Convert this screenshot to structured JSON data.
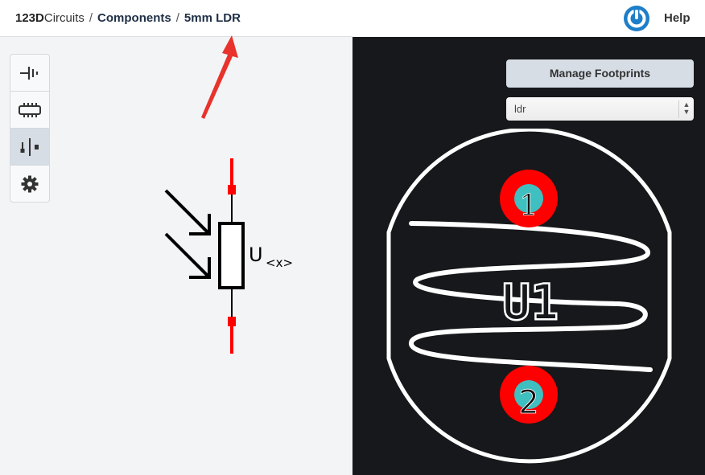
{
  "breadcrumb": {
    "brand_bold": "123D",
    "brand_regular": "Circuits",
    "separator": "/",
    "items": [
      "Components",
      "5mm LDR"
    ]
  },
  "header": {
    "help_label": "Help",
    "power_icon": "power-icon"
  },
  "toolbar": {
    "tools": [
      {
        "name": "schematic-tool",
        "icon": "battery-icon",
        "active": false
      },
      {
        "name": "breadboard-tool",
        "icon": "chip-icon",
        "active": false
      },
      {
        "name": "pcb-tool",
        "icon": "pcb-pin-icon",
        "active": true
      },
      {
        "name": "settings-tool",
        "icon": "gear-icon",
        "active": false
      }
    ]
  },
  "schematic": {
    "label_main": "U",
    "label_sub": "<x>"
  },
  "pcb_panel": {
    "manage_footprints_label": "Manage Footprints",
    "footprint_select_value": "ldr",
    "refdes": "U1",
    "pads": [
      "1",
      "2"
    ]
  },
  "colors": {
    "pad_red": "#ff0000",
    "pad_drill": "#3fbfbf",
    "accent_blue": "#1e7ec8",
    "arrow_red": "#e8322b"
  }
}
